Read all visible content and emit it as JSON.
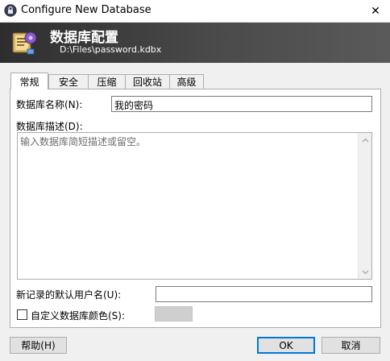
{
  "window": {
    "title": "Configure New Database",
    "close_glyph": "✕"
  },
  "banner": {
    "title": "数据库配置",
    "subtitle": "D:\\Files\\password.kdbx"
  },
  "tabs": [
    {
      "label": "常规",
      "active": true
    },
    {
      "label": "安全",
      "active": false
    },
    {
      "label": "压缩",
      "active": false
    },
    {
      "label": "回收站",
      "active": false
    },
    {
      "label": "高级",
      "active": false
    }
  ],
  "general": {
    "name_label": "数据库名称(N):",
    "name_value": "我的密码",
    "description_label": "数据库描述(D):",
    "description_placeholder": "输入数据库简短描述或留空。",
    "default_user_label": "新记录的默认用户名(U):",
    "default_user_value": "",
    "custom_color_label": "自定义数据库颜色(S):",
    "custom_color_checked": false,
    "custom_color_value": "#cfcfcf"
  },
  "buttons": {
    "help": "帮助(H)",
    "ok": "OK",
    "cancel": "取消"
  },
  "colors": {
    "accent": "#0078d7",
    "banner_dark": "#2e2e2e"
  },
  "icons": {
    "title_icon": "lock-icon",
    "banner_icon": "database-gear-icon"
  }
}
